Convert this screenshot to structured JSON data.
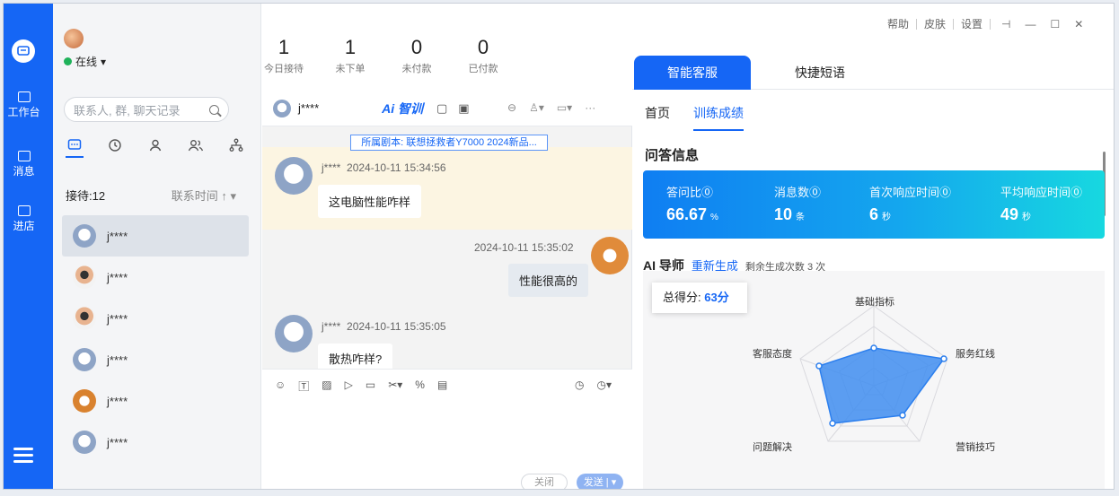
{
  "profile": {
    "status": "在线",
    "status_caret": "▾"
  },
  "rail": {
    "items": [
      "工作台",
      "消息",
      "进店"
    ]
  },
  "stats": [
    {
      "value": "1",
      "label": "今日接待"
    },
    {
      "value": "1",
      "label": "未下单"
    },
    {
      "value": "0",
      "label": "未付款"
    },
    {
      "value": "0",
      "label": "已付款"
    }
  ],
  "search": {
    "placeholder": "联系人, 群, 聊天记录"
  },
  "queue": {
    "label": "接待:12",
    "sort": "联系时间 ↑ ▾"
  },
  "contacts": [
    {
      "name": "j****",
      "avatar": "bear"
    },
    {
      "name": "j****",
      "avatar": "doll"
    },
    {
      "name": "j****",
      "avatar": "doll"
    },
    {
      "name": "j****",
      "avatar": "bear"
    },
    {
      "name": "j****",
      "avatar": "dog"
    },
    {
      "name": "j****",
      "avatar": "bear"
    }
  ],
  "chat": {
    "contact": "j****",
    "ai_label": "Ai 智训",
    "script_tag": "所属剧本: 联想拯救者Y7000 2024新品...",
    "messages": [
      {
        "sender": "j****",
        "time": "2024-10-11 15:34:56",
        "text": "这电脑性能咋样"
      },
      {
        "sender": "",
        "time": "2024-10-11 15:35:02",
        "text": "性能很高的"
      },
      {
        "sender": "j****",
        "time": "2024-10-11 15:35:05",
        "text": "散热咋样?"
      }
    ],
    "close_label": "关闭",
    "send_label": "发送 | ▾"
  },
  "window": {
    "help": "帮助",
    "skin": "皮肤",
    "settings": "设置"
  },
  "right_panel": {
    "tabs": [
      "智能客服",
      "快捷短语"
    ],
    "subtabs": [
      "首页",
      "训练成绩"
    ],
    "section_title": "问答信息",
    "metrics": [
      {
        "label": "答问比⓪",
        "value": "66.67",
        "unit": "%"
      },
      {
        "label": "消息数⓪",
        "value": "10",
        "unit": "条"
      },
      {
        "label": "首次响应时间⓪",
        "value": "6",
        "unit": "秒"
      },
      {
        "label": "平均响应时间⓪",
        "value": "49",
        "unit": "秒"
      }
    ],
    "ai_mentor": {
      "title": "AI 导师",
      "regenerate": "重新生成",
      "remaining": "剩余生成次数 3 次"
    },
    "score": {
      "label": "总得分:",
      "value": "63分"
    },
    "radar": {
      "axes": [
        "基础指标",
        "服务红线",
        "营销技巧",
        "问题解决",
        "客服态度"
      ]
    }
  },
  "colors": {
    "brand": "#1566f5",
    "online": "#1fb25a"
  }
}
